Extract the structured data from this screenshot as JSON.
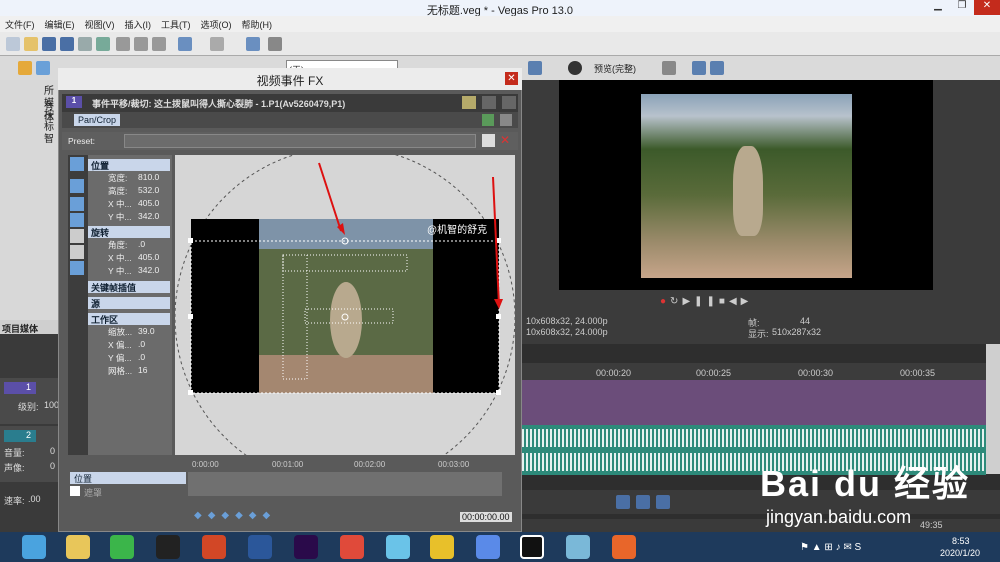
{
  "app": {
    "title": "无标题.veg * - Vegas Pro 13.0"
  },
  "menu": [
    "文件(F)",
    "编辑(E)",
    "视图(V)",
    "插入(I)",
    "工具(T)",
    "选项(O)",
    "帮助(H)"
  ],
  "toolbar2": {
    "dropdown": "(无)",
    "preview_quality": "预览(完整)"
  },
  "tree": {
    "items": [
      "所有",
      "媒体",
      "按",
      "标",
      "智"
    ]
  },
  "project_tab": "项目媒体",
  "tracks": {
    "video": {
      "num": "1",
      "level_label": "级别:",
      "level_value": "100"
    },
    "audio": {
      "num": "2",
      "volume_label": "音量:",
      "volume_value": "0",
      "pan_label": "声像:",
      "pan_value": "0"
    },
    "rate_label": "速率:",
    "rate_value": ".00"
  },
  "preview": {
    "info_left": [
      "10x608x32, 24.000p",
      "10x608x32, 24.000p"
    ],
    "frame_label": "帧:",
    "frame_value": "44",
    "display_label": "显示:",
    "display_value": "510x287x32"
  },
  "timeline": {
    "ruler": [
      "00:00:20",
      "00:00:25",
      "00:00:30",
      "00:00:35"
    ],
    "timecode": "49:35"
  },
  "dialog": {
    "title": "视频事件 FX",
    "header": "事件平移/裁切: 这土拨鼠叫得人撕心裂肺 - 1.P1(Av5260479,P1)",
    "plugin": "Pan/Crop",
    "preset_label": "Preset:",
    "sections": {
      "position": {
        "label": "位置",
        "rows": [
          {
            "k": "宽度:",
            "v": "810.0"
          },
          {
            "k": "高度:",
            "v": "532.0"
          },
          {
            "k": "X 中...",
            "v": "405.0"
          },
          {
            "k": "Y 中...",
            "v": "342.0"
          }
        ]
      },
      "rotation": {
        "label": "旋转",
        "rows": [
          {
            "k": "角度:",
            "v": ".0"
          },
          {
            "k": "X 中...",
            "v": "405.0"
          },
          {
            "k": "Y 中...",
            "v": "342.0"
          }
        ]
      },
      "keyframe": {
        "label": "关键帧插值"
      },
      "source": {
        "label": "源"
      },
      "workspace": {
        "label": "工作区",
        "rows": [
          {
            "k": "缩放...",
            "v": "39.0"
          },
          {
            "k": "X 偏...",
            "v": ".0"
          },
          {
            "k": "Y 偏...",
            "v": ".0"
          },
          {
            "k": "网格...",
            "v": "16"
          }
        ]
      }
    },
    "watermark_text": "@机智的舒克",
    "keyframes": {
      "ruler": [
        "0:00:00",
        "00:01:00",
        "00:02:00",
        "00:03:00"
      ],
      "track_label": "位置",
      "mask_label": "遮罩",
      "time": "00:00:00.00"
    }
  },
  "watermark": {
    "brand": "Bai du 经验",
    "url": "jingyan.baidu.com"
  },
  "taskbar": {
    "time": "8:53",
    "date": "2020/1/20"
  }
}
